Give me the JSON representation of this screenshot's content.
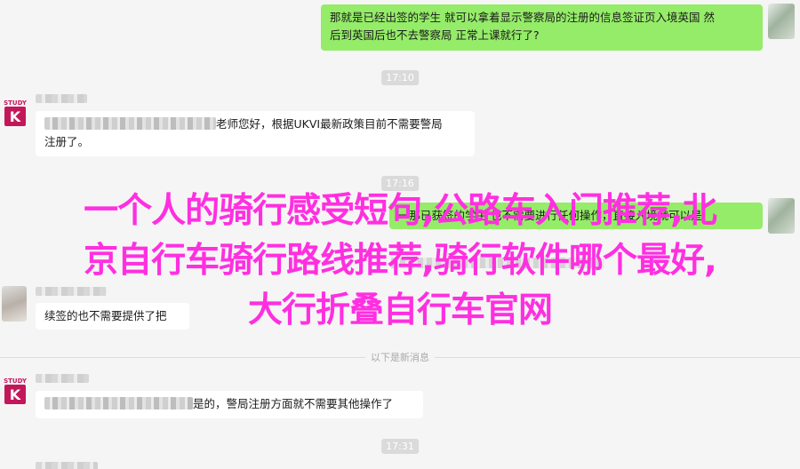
{
  "messages": {
    "m1": {
      "line1": "那就是已经出签的学生 就可以拿着显示警察局的注册的信息签证页入境英国 然",
      "line2": "后到英国后也不去警察局 正常上课就行了?"
    },
    "m2": {
      "line1_suffix": "老师您好，根据UKVI最新政策目前不需要警局",
      "line2": "注册了。"
    },
    "m3": {
      "text": "一那已获签的学生 也不需要进行任何操作，直接入境就可以是"
    },
    "m4": {
      "text": "续签的也不需要提供了把"
    },
    "m5": {
      "text_suffix": "是的，警局注册方面就不需要其他操作了"
    }
  },
  "times": {
    "t1": "17:10",
    "t2": "17:16",
    "t3": "17:31"
  },
  "divider_text": "以下是新消息",
  "avatars": {
    "study_label": "STUDY",
    "study_letter": "K"
  },
  "overlay": {
    "line1": "一个人的骑行感受短句,公路车入门推荐,北",
    "line2": "京自行车骑行路线推荐,骑行软件哪个最好,",
    "line3": "大行折叠自行车官网"
  },
  "colors": {
    "self_bubble": "#95ec69",
    "other_bubble": "#ffffff",
    "overlay_text": "#ff2fe0"
  }
}
